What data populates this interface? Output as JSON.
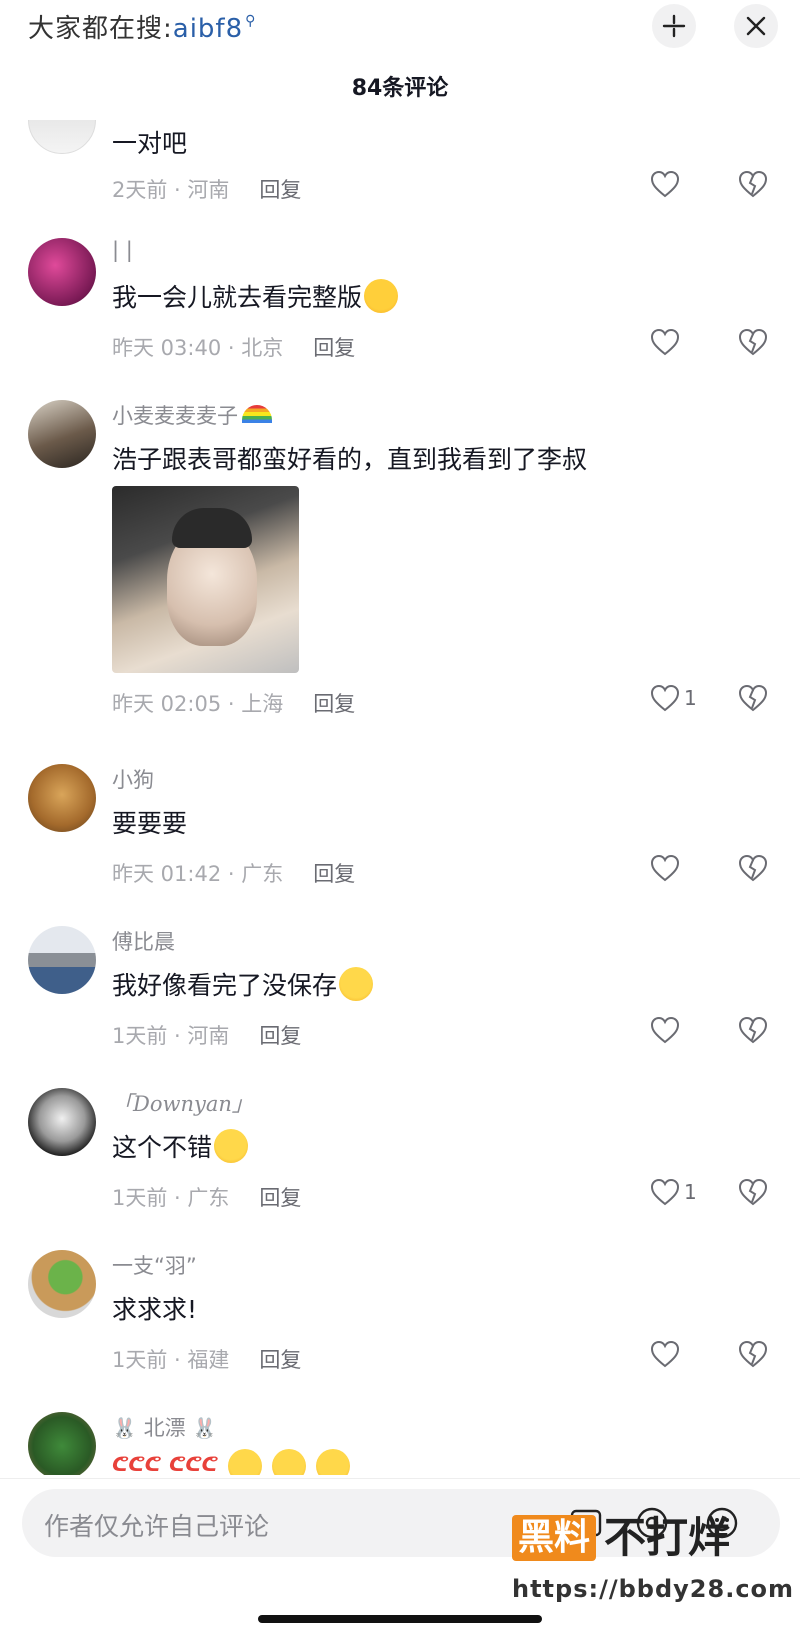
{
  "header": {
    "search_hint_prefix": "大家都在搜:",
    "search_hint_keyword": "aibf8",
    "shrink_icon": "collapse-icon",
    "close_icon": "close-icon"
  },
  "comment_count": "84条评论",
  "comments": [
    {
      "name": "",
      "text": "一对吧",
      "time": "2天前 · 河南",
      "reply": "回复",
      "likes": ""
    },
    {
      "name": "| |",
      "text": "我一会儿就去看完整版",
      "emoji": "heart-eyes-emoji",
      "time": "昨天 03:40 · 北京",
      "reply": "回复",
      "likes": ""
    },
    {
      "name": "小麦麦麦麦子",
      "name_emoji": "rainbow-emoji",
      "text": "浩子跟表哥都蛮好看的，直到我看到了李叔",
      "time": "昨天 02:05 · 上海",
      "reply": "回复",
      "likes": "1"
    },
    {
      "name": "小狗",
      "text": "要要要",
      "time": "昨天 01:42 · 广东",
      "reply": "回复",
      "likes": ""
    },
    {
      "name": "傅比晨",
      "text": "我好像看完了没保存",
      "emoji": "sad-face-emoji",
      "time": "1天前 · 河南",
      "reply": "回复",
      "likes": ""
    },
    {
      "name": "「Downyan」",
      "text": "这个不错",
      "emoji": "hug-emoji",
      "time": "1天前 · 广东",
      "reply": "回复",
      "likes": "1"
    },
    {
      "name": "一支“羽”",
      "text": "求求求!",
      "time": "1天前 · 福建",
      "reply": "回复",
      "likes": ""
    },
    {
      "name": "北漂",
      "name_emoji": "rabbit-emoji",
      "text": "",
      "time": "",
      "reply": "",
      "likes": ""
    }
  ],
  "input": {
    "placeholder": "作者仅允许自己评论"
  },
  "watermark": {
    "badge": "黑料",
    "text": "不打烊",
    "url": "https://bbdy28.com"
  },
  "colors": {
    "accent_link": "#2a5fa8",
    "watermark_orange": "#f08a1c",
    "meta_gray": "#a8a9ae"
  }
}
